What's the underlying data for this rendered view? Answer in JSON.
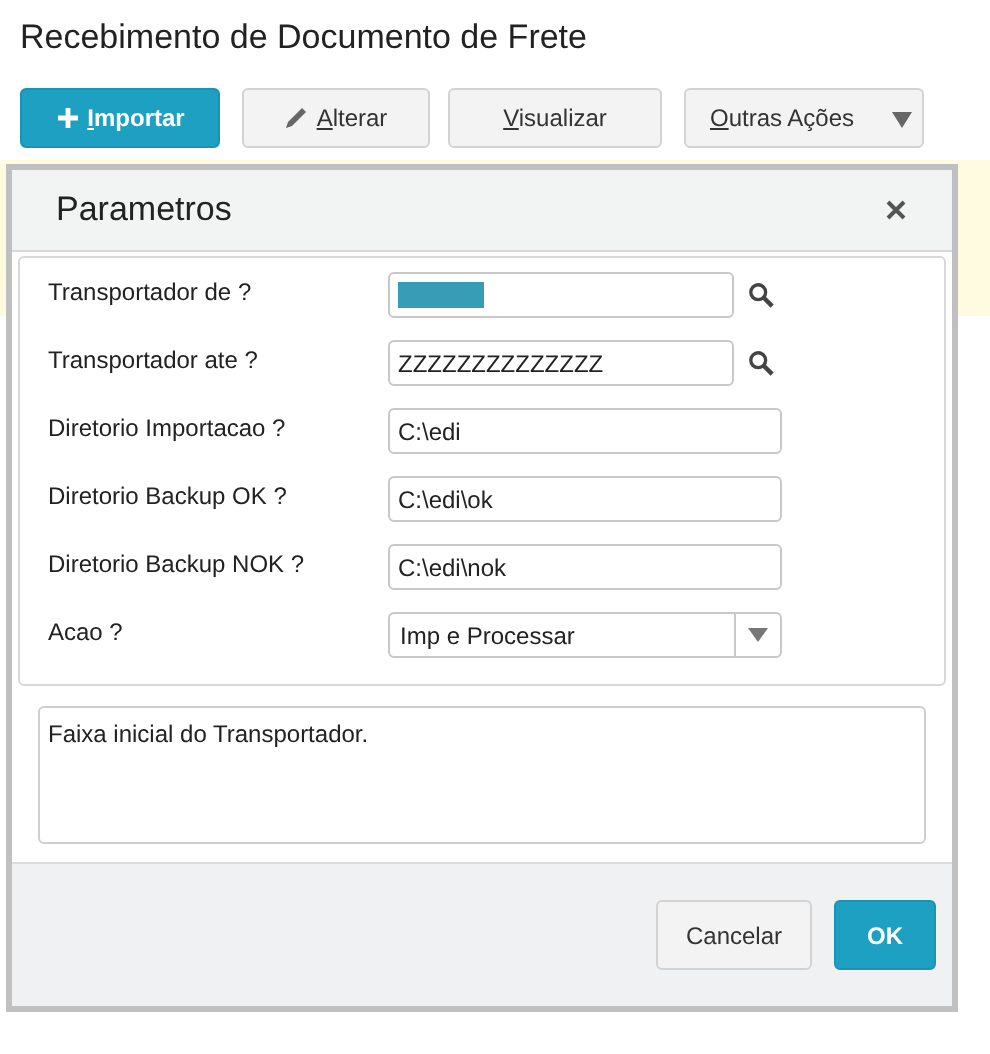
{
  "page": {
    "title": "Recebimento de Documento de Frete"
  },
  "toolbar": [
    {
      "label": "Importar",
      "kind": "primary",
      "mnemonic": true
    },
    {
      "label": "Alterar",
      "kind": "edit",
      "mnemonic": true
    },
    {
      "label": "Visualizar",
      "kind": "default",
      "mnemonic": true
    },
    {
      "label": "Outras Ações",
      "kind": "dropdown",
      "mnemonic": true
    }
  ],
  "dialog": {
    "title": "Parametros",
    "fields": [
      {
        "label": "Transportador de ?",
        "kind": "lookup",
        "text_selected": true
      },
      {
        "label": "Transportador ate ?",
        "kind": "lookup",
        "value": "ZZZZZZZZZZZZZZ",
        "text_selected": false
      },
      {
        "label": "Diretorio Importacao ?",
        "kind": "text",
        "value": "C:\\edi",
        "text_selected": false
      },
      {
        "label": "Diretorio Backup OK ?",
        "kind": "text",
        "value": "C:\\edi\\ok",
        "text_selected": false
      },
      {
        "label": "Diretorio Backup NOK ?",
        "kind": "text",
        "value": "C:\\edi\\nok",
        "text_selected": false
      },
      {
        "label": "Acao ?",
        "kind": "select",
        "value": "Imp e Processar",
        "text_selected": false
      }
    ],
    "help_text": "Faixa inicial do Transportador.",
    "buttons": [
      {
        "label": "Cancelar",
        "kind": "default"
      },
      {
        "label": "OK",
        "kind": "primary"
      }
    ]
  }
}
